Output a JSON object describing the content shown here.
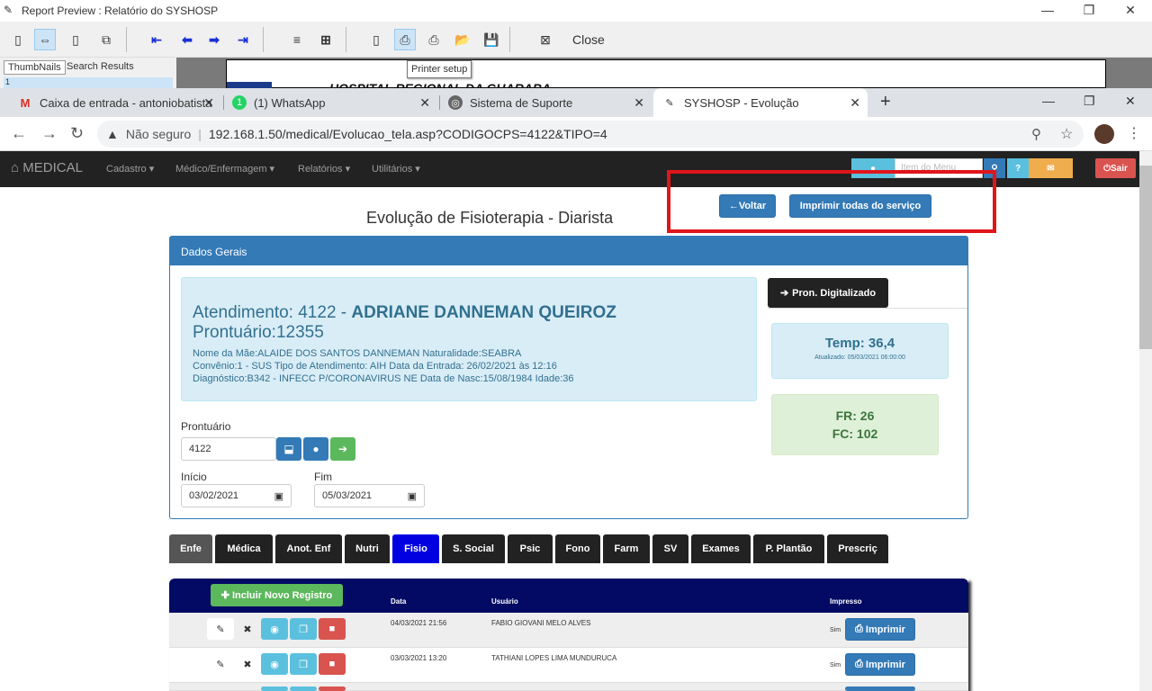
{
  "report_preview": {
    "title": "Report Preview : Relatório do SYSHOSP",
    "close_label": "Close",
    "tabs": [
      "ThumbNails",
      "Search Results"
    ],
    "thumb_page": "1",
    "tooltip": "Printer setup",
    "doc_heading": "HOSPITAL REGIONAL DA GUARABA"
  },
  "browser": {
    "tabs": [
      {
        "title": "Caixa de entrada - antoniobatista",
        "icon": "gmail-icon"
      },
      {
        "title": "(1) WhatsApp",
        "icon": "whatsapp-icon"
      },
      {
        "title": "Sistema de Suporte",
        "icon": "globe-icon"
      },
      {
        "title": "SYSHOSP - Evolução",
        "icon": "syshosp-icon"
      }
    ],
    "security": "Não seguro",
    "url": "192.168.1.50/medical/Evolucao_tela.asp?CODIGOCPS=4122&TIPO=4"
  },
  "navbar": {
    "brand": "MEDICAL",
    "items": [
      "Cadastro",
      "Médico/Enfermagem",
      "Relatórios",
      "Utilitários"
    ],
    "search_placeholder": "Item do Menu",
    "exit_label": "Sair"
  },
  "actions": {
    "back": "Voltar",
    "print_all": "Imprimir todas do serviço"
  },
  "page_title": "Evolução de Fisioterapia - Diarista",
  "panel": {
    "heading": "Dados Gerais",
    "atendimento_label": "Atendimento: 4122 -",
    "patient_name": "ADRIANE DANNEMAN QUEIROZ",
    "prontuario_line": "Prontuário:12355",
    "line1": "Nome da Mãe:ALAIDE DOS SANTOS DANNEMAN Naturalidade:SEABRA",
    "line2": "Convênio:1 - SUS Tipo de Atendimento: AIH Data da Entrada: 26/02/2021 às 12:16",
    "line3": "Diagnóstico:B342 - INFECC P/CORONAVIRUS NE Data de Nasc:15/08/1984 Idade:36",
    "pron_button": "Pron. Digitalizado",
    "temp": "Temp: 36,4",
    "temp_updated": "Atualizado: 05/03/2021 06:00:00",
    "fr": "FR: 26",
    "fc": "FC: 102",
    "prontuario_label": "Prontuário",
    "prontuario_value": "4122",
    "inicio_label": "Início",
    "inicio_value": "03/02/2021",
    "fim_label": "Fim",
    "fim_value": "05/03/2021"
  },
  "tabs": [
    "Enfe",
    "Médica",
    "Anot. Enf",
    "Nutri",
    "Fisio",
    "S. Social",
    "Psic",
    "Fono",
    "Farm",
    "SV",
    "Exames",
    "P. Plantão",
    "Prescriç"
  ],
  "table": {
    "add_button": "Incluir Novo Registro",
    "headers": [
      "Data",
      "Usuário",
      "Impresso"
    ],
    "rows": [
      {
        "date": "04/03/2021 21:56",
        "user": "FABIO GIOVANI MELO ALVES",
        "printed": "Sim",
        "print_label": "Imprimir"
      },
      {
        "date": "03/03/2021 13:20",
        "user": "TATHIANI LOPES LIMA MUNDURUCA",
        "printed": "Sim",
        "print_label": "Imprimir"
      }
    ]
  }
}
